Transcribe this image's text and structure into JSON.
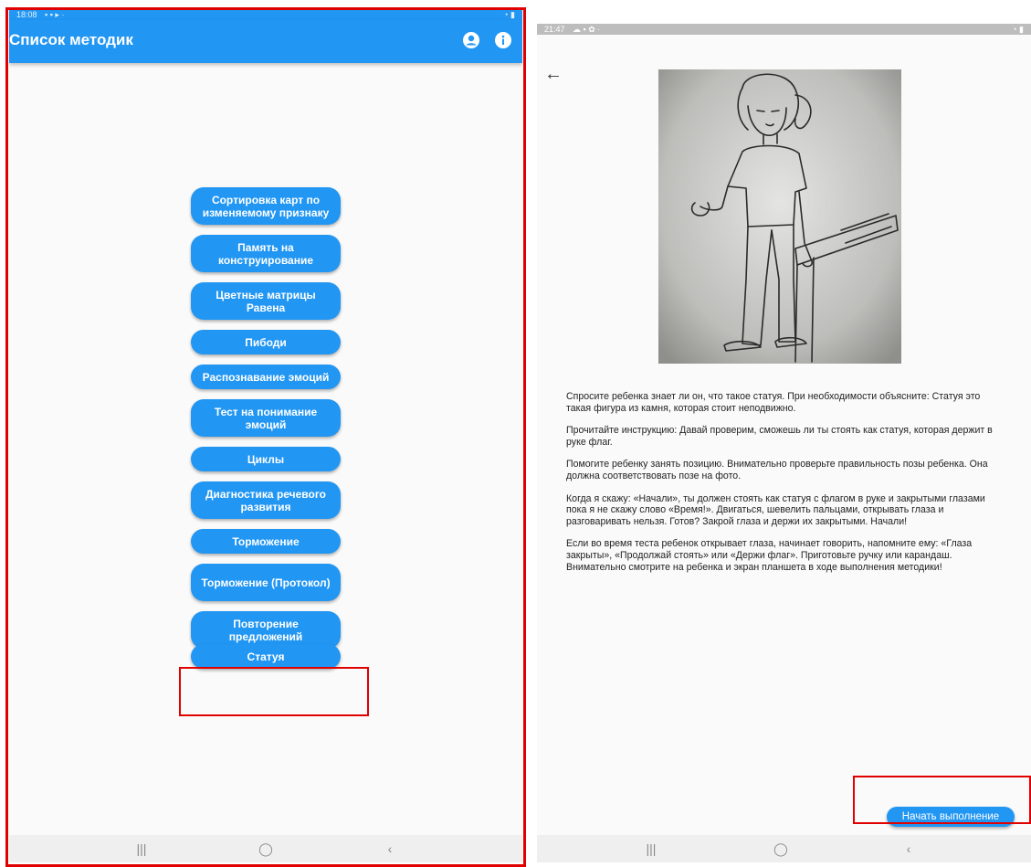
{
  "left_screen": {
    "status": {
      "time": "18:08"
    },
    "appbar": {
      "title": "Список методик",
      "icons": [
        "account-circle-icon",
        "info-icon"
      ]
    },
    "methods": [
      "Сортировка карт по изменяемому признаку",
      "Память на конструирование",
      "Цветные матрицы Равена",
      "Пибоди",
      "Распознавание эмоций",
      "Тест на понимание эмоций",
      "Циклы",
      "Диагностика речевого развития",
      "Торможение",
      "Торможение (Протокол)",
      "Повторение предложений",
      "Статуя"
    ]
  },
  "right_screen": {
    "status": {
      "time": "21:47"
    },
    "instructions": [
      "Спросите ребенка знает ли он, что такое статуя. При необходимости объясните: Статуя это такая фигура из камня, которая стоит неподвижно.",
      "Прочитайте инструкцию: Давай проверим, сможешь ли ты стоять как статуя, которая держит в руке флаг.",
      "Помогите ребенку занять позицию. Внимательно проверьте правильность позы ребенка. Она должна соответствовать позе на фото.",
      "Когда я скажу: «Начали», ты должен стоять как статуя с флагом в руке и закрытыми глазами пока я не скажу слово «Время!». Двигаться, шевелить пальцами, открывать глаза и разговаривать нельзя. Готов? Закрой глаза и держи их закрытыми. Начали!",
      "Если во время теста ребенок открывает глаза, начинает говорить, напомните ему: «Глаза закрыты», «Продолжай стоять» или «Держи флаг». Приготовьте ручку или карандаш. Внимательно смотрите на ребенка и экран планшета в ходе выполнения методики!"
    ],
    "start_button": "Начать выполнение"
  },
  "colors": {
    "primary": "#2196F3",
    "highlight": "#e00000"
  }
}
